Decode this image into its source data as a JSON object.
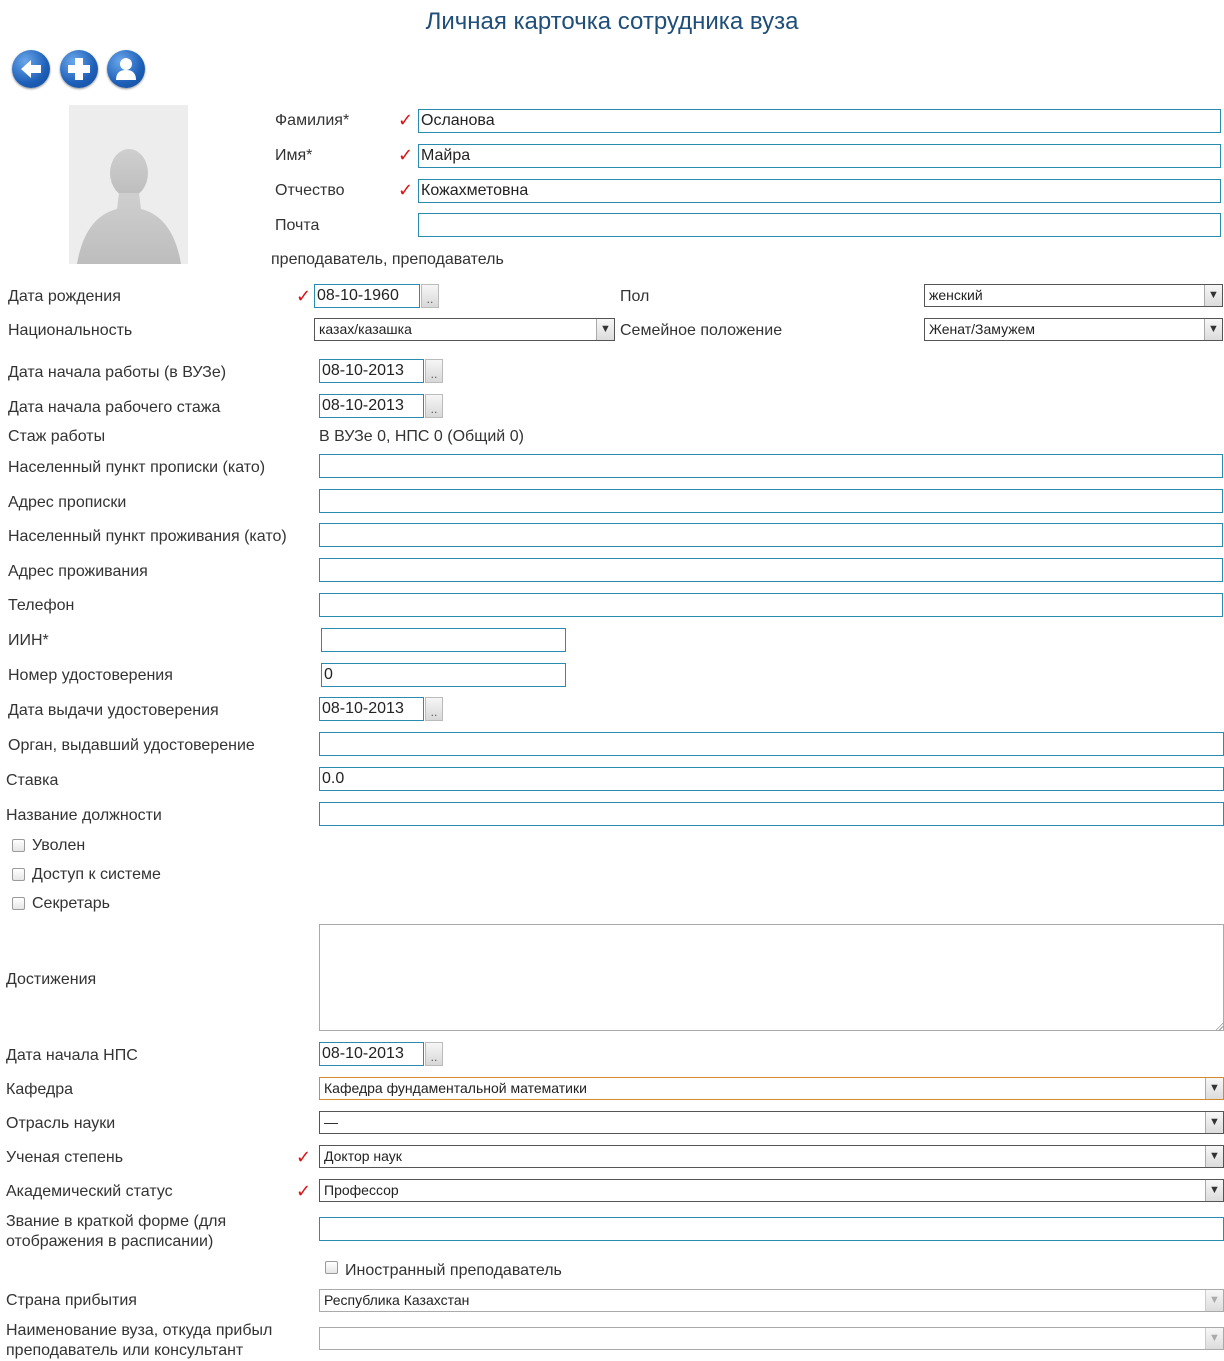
{
  "page": {
    "title": "Личная карточка сотрудника вуза"
  },
  "toolbar": {
    "back_icon": "back-arrow-icon",
    "add_icon": "add-plus-icon",
    "profile_icon": "user-profile-icon"
  },
  "colors": {
    "title": "#1f4e79",
    "input_border": "#2a8ab0",
    "required_mark": "#dd1111",
    "button_blue": "#1d5fb8"
  },
  "required_mark": "✓",
  "date_button": "..",
  "header_fields": {
    "lastname": {
      "label": "Фамилия*",
      "value": "Осланова"
    },
    "firstname": {
      "label": "Имя*",
      "value": "Майра"
    },
    "patronymic": {
      "label": "Отчество",
      "value": "Кожахметовна"
    },
    "email": {
      "label": "Почта",
      "value": ""
    },
    "position_text": "преподаватель, преподаватель"
  },
  "form": {
    "birth_date": {
      "label": "Дата рождения",
      "value": "08-10-1960"
    },
    "gender": {
      "label": "Пол",
      "value": "женский"
    },
    "nationality": {
      "label": "Национальность",
      "value": "казах/казашка"
    },
    "marital_status": {
      "label": "Семейное положение",
      "value": "Женат/Замужем"
    },
    "work_start_university": {
      "label": "Дата начала работы (в ВУЗе)",
      "value": "08-10-2013"
    },
    "work_experience_start": {
      "label": "Дата начала рабочего стажа",
      "value": "08-10-2013"
    },
    "experience": {
      "label": "Стаж работы",
      "value": "В ВУЗе 0, НПС 0 (Общий 0)"
    },
    "registration_locality": {
      "label": "Населенный пункт прописки (като)",
      "value": ""
    },
    "registration_address": {
      "label": "Адрес прописки",
      "value": ""
    },
    "residence_locality": {
      "label": "Населенный пункт проживания (като)",
      "value": ""
    },
    "residence_address": {
      "label": "Адрес проживания",
      "value": ""
    },
    "phone": {
      "label": "Телефон",
      "value": ""
    },
    "iin": {
      "label": "ИИН*",
      "value": ""
    },
    "id_number": {
      "label": "Номер удостоверения",
      "value": "0"
    },
    "id_issue_date": {
      "label": "Дата выдачи удостоверения",
      "value": "08-10-2013"
    },
    "id_issuer": {
      "label": "Орган, выдавший удостоверение",
      "value": ""
    },
    "rate": {
      "label": "Ставка",
      "value": "0.0"
    },
    "job_title": {
      "label": "Название должности",
      "value": ""
    },
    "dismissed": {
      "label": "Уволен",
      "checked": false
    },
    "system_access": {
      "label": "Доступ к системе",
      "checked": false
    },
    "secretary": {
      "label": "Секретарь",
      "checked": false
    },
    "achievements": {
      "label": "Достижения",
      "value": ""
    },
    "nps_start": {
      "label": "Дата начала НПС",
      "value": "08-10-2013"
    },
    "department": {
      "label": "Кафедра",
      "value": "Кафедра фундаментальной математики"
    },
    "science_branch": {
      "label": "Отрасль науки",
      "value": "—"
    },
    "degree": {
      "label": "Ученая степень",
      "value": "Доктор наук"
    },
    "academic_status": {
      "label": "Академический статус",
      "value": "Профессор"
    },
    "short_title": {
      "label": "Звание в краткой форме (для отображения в расписании)",
      "value": ""
    },
    "foreign_teacher": {
      "label": "Иностранный преподаватель",
      "checked": false
    },
    "arrival_country": {
      "label": "Страна прибытия",
      "value": "Республика Казахстан"
    },
    "origin_university": {
      "label": "Наименование вуза, откуда прибыл преподаватель или консультант",
      "value": ""
    }
  }
}
